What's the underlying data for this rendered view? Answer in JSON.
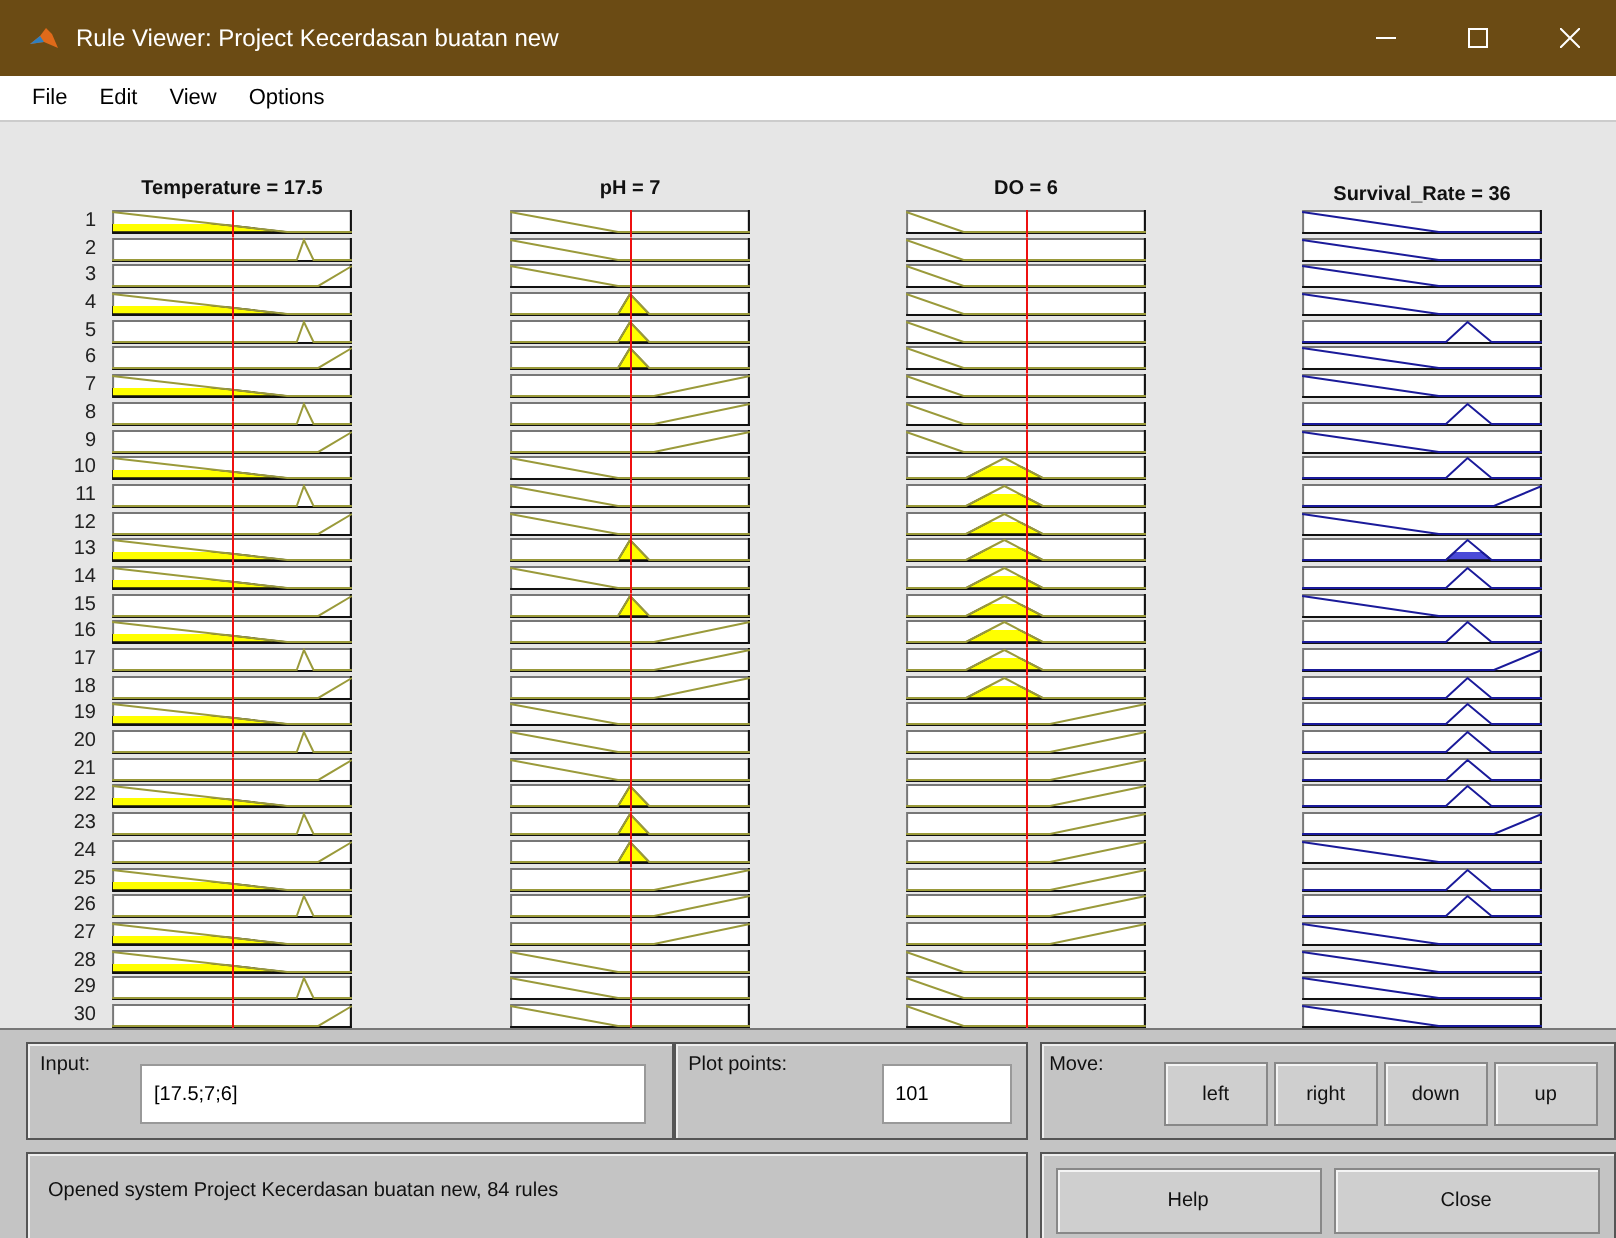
{
  "window": {
    "title": "Rule Viewer: Project Kecerdasan buatan new"
  },
  "menu": [
    "File",
    "Edit",
    "View",
    "Options"
  ],
  "variables": [
    {
      "label": "Temperature = 17.5",
      "kind": "input"
    },
    {
      "label": "pH = 7",
      "kind": "input"
    },
    {
      "label": "DO = 6",
      "kind": "input"
    },
    {
      "label": "Survival_Rate = 36",
      "kind": "output"
    }
  ],
  "rules": [
    {
      "number": "1",
      "cells": [
        {
          "kind": "low",
          "fired": true
        },
        {
          "kind": "low",
          "fired": false
        },
        {
          "kind": "low",
          "fired": false
        },
        {
          "kind": "low",
          "fired": false
        }
      ]
    },
    {
      "number": "2",
      "cells": [
        {
          "kind": "mid",
          "fired": false
        },
        {
          "kind": "low",
          "fired": false
        },
        {
          "kind": "low",
          "fired": false
        },
        {
          "kind": "low",
          "fired": false
        }
      ]
    },
    {
      "number": "3",
      "cells": [
        {
          "kind": "high",
          "fired": false
        },
        {
          "kind": "low",
          "fired": false
        },
        {
          "kind": "low",
          "fired": false
        },
        {
          "kind": "low",
          "fired": false
        }
      ]
    },
    {
      "number": "4",
      "cells": [
        {
          "kind": "low",
          "fired": true
        },
        {
          "kind": "mid",
          "fired": true
        },
        {
          "kind": "low",
          "fired": false
        },
        {
          "kind": "low",
          "fired": false
        }
      ]
    },
    {
      "number": "5",
      "cells": [
        {
          "kind": "mid",
          "fired": false
        },
        {
          "kind": "mid",
          "fired": true
        },
        {
          "kind": "low",
          "fired": false
        },
        {
          "kind": "mid",
          "fired": false
        }
      ]
    },
    {
      "number": "6",
      "cells": [
        {
          "kind": "high",
          "fired": false
        },
        {
          "kind": "mid",
          "fired": true
        },
        {
          "kind": "low",
          "fired": false
        },
        {
          "kind": "low",
          "fired": false
        }
      ]
    },
    {
      "number": "7",
      "cells": [
        {
          "kind": "low",
          "fired": true
        },
        {
          "kind": "high",
          "fired": false
        },
        {
          "kind": "low",
          "fired": false
        },
        {
          "kind": "low",
          "fired": false
        }
      ]
    },
    {
      "number": "8",
      "cells": [
        {
          "kind": "mid",
          "fired": false
        },
        {
          "kind": "high",
          "fired": false
        },
        {
          "kind": "low",
          "fired": false
        },
        {
          "kind": "mid",
          "fired": false
        }
      ]
    },
    {
      "number": "9",
      "cells": [
        {
          "kind": "high",
          "fired": false
        },
        {
          "kind": "high",
          "fired": false
        },
        {
          "kind": "low",
          "fired": false
        },
        {
          "kind": "low",
          "fired": false
        }
      ]
    },
    {
      "number": "10",
      "cells": [
        {
          "kind": "low",
          "fired": true
        },
        {
          "kind": "low",
          "fired": false
        },
        {
          "kind": "mid",
          "fired": true
        },
        {
          "kind": "mid",
          "fired": false
        }
      ]
    },
    {
      "number": "11",
      "cells": [
        {
          "kind": "mid",
          "fired": false
        },
        {
          "kind": "low",
          "fired": false
        },
        {
          "kind": "mid",
          "fired": true
        },
        {
          "kind": "high",
          "fired": false
        }
      ]
    },
    {
      "number": "12",
      "cells": [
        {
          "kind": "high",
          "fired": false
        },
        {
          "kind": "low",
          "fired": false
        },
        {
          "kind": "mid",
          "fired": true
        },
        {
          "kind": "low",
          "fired": false
        }
      ]
    },
    {
      "number": "13",
      "cells": [
        {
          "kind": "low",
          "fired": true
        },
        {
          "kind": "mid",
          "fired": true
        },
        {
          "kind": "mid",
          "fired": true
        },
        {
          "kind": "mid",
          "fired": true
        }
      ]
    },
    {
      "number": "14",
      "cells": [
        {
          "kind": "low",
          "fired": true
        },
        {
          "kind": "low",
          "fired": false
        },
        {
          "kind": "mid",
          "fired": true
        },
        {
          "kind": "mid",
          "fired": false
        }
      ]
    },
    {
      "number": "15",
      "cells": [
        {
          "kind": "high",
          "fired": false
        },
        {
          "kind": "mid",
          "fired": true
        },
        {
          "kind": "mid",
          "fired": true
        },
        {
          "kind": "low",
          "fired": false
        }
      ]
    },
    {
      "number": "16",
      "cells": [
        {
          "kind": "low",
          "fired": true
        },
        {
          "kind": "high",
          "fired": false
        },
        {
          "kind": "mid",
          "fired": true
        },
        {
          "kind": "mid",
          "fired": false
        }
      ]
    },
    {
      "number": "17",
      "cells": [
        {
          "kind": "mid",
          "fired": false
        },
        {
          "kind": "high",
          "fired": false
        },
        {
          "kind": "mid",
          "fired": true
        },
        {
          "kind": "high",
          "fired": false
        }
      ]
    },
    {
      "number": "18",
      "cells": [
        {
          "kind": "high",
          "fired": false
        },
        {
          "kind": "high",
          "fired": false
        },
        {
          "kind": "mid",
          "fired": true
        },
        {
          "kind": "mid",
          "fired": false
        }
      ]
    },
    {
      "number": "19",
      "cells": [
        {
          "kind": "low",
          "fired": true
        },
        {
          "kind": "low",
          "fired": false
        },
        {
          "kind": "high",
          "fired": false
        },
        {
          "kind": "mid",
          "fired": false
        }
      ]
    },
    {
      "number": "20",
      "cells": [
        {
          "kind": "mid",
          "fired": false
        },
        {
          "kind": "low",
          "fired": false
        },
        {
          "kind": "high",
          "fired": false
        },
        {
          "kind": "mid",
          "fired": false
        }
      ]
    },
    {
      "number": "21",
      "cells": [
        {
          "kind": "high",
          "fired": false
        },
        {
          "kind": "low",
          "fired": false
        },
        {
          "kind": "high",
          "fired": false
        },
        {
          "kind": "mid",
          "fired": false
        }
      ]
    },
    {
      "number": "22",
      "cells": [
        {
          "kind": "low",
          "fired": true
        },
        {
          "kind": "mid",
          "fired": true
        },
        {
          "kind": "high",
          "fired": false
        },
        {
          "kind": "mid",
          "fired": false
        }
      ]
    },
    {
      "number": "23",
      "cells": [
        {
          "kind": "mid",
          "fired": false
        },
        {
          "kind": "mid",
          "fired": true
        },
        {
          "kind": "high",
          "fired": false
        },
        {
          "kind": "high",
          "fired": false
        }
      ]
    },
    {
      "number": "24",
      "cells": [
        {
          "kind": "high",
          "fired": false
        },
        {
          "kind": "mid",
          "fired": true
        },
        {
          "kind": "high",
          "fired": false
        },
        {
          "kind": "low",
          "fired": false
        }
      ]
    },
    {
      "number": "25",
      "cells": [
        {
          "kind": "low",
          "fired": true
        },
        {
          "kind": "high",
          "fired": false
        },
        {
          "kind": "high",
          "fired": false
        },
        {
          "kind": "mid",
          "fired": false
        }
      ]
    },
    {
      "number": "26",
      "cells": [
        {
          "kind": "mid",
          "fired": false
        },
        {
          "kind": "high",
          "fired": false
        },
        {
          "kind": "high",
          "fired": false
        },
        {
          "kind": "mid",
          "fired": false
        }
      ]
    },
    {
      "number": "27",
      "cells": [
        {
          "kind": "low",
          "fired": true
        },
        {
          "kind": "high",
          "fired": false
        },
        {
          "kind": "high",
          "fired": false
        },
        {
          "kind": "low",
          "fired": false
        }
      ]
    },
    {
      "number": "28",
      "cells": [
        {
          "kind": "low",
          "fired": true
        },
        {
          "kind": "low",
          "fired": false
        },
        {
          "kind": "low",
          "fired": false
        },
        {
          "kind": "low",
          "fired": false
        }
      ]
    },
    {
      "number": "29",
      "cells": [
        {
          "kind": "mid",
          "fired": false
        },
        {
          "kind": "low",
          "fired": false
        },
        {
          "kind": "low",
          "fired": false
        },
        {
          "kind": "low",
          "fired": false
        }
      ]
    },
    {
      "number": "30",
      "cells": [
        {
          "kind": "high",
          "fired": false
        },
        {
          "kind": "low",
          "fired": false
        },
        {
          "kind": "low",
          "fired": false
        },
        {
          "kind": "low",
          "fired": false
        }
      ]
    }
  ],
  "input": {
    "label": "Input:",
    "value": "[17.5;7;6]"
  },
  "plot_points": {
    "label": "Plot points:",
    "value": "101"
  },
  "move": {
    "label": "Move:",
    "buttons": [
      "left",
      "right",
      "down",
      "up"
    ]
  },
  "status": "Opened system Project Kecerdasan buatan new, 84 rules",
  "buttons": [
    "Help",
    "Close"
  ]
}
